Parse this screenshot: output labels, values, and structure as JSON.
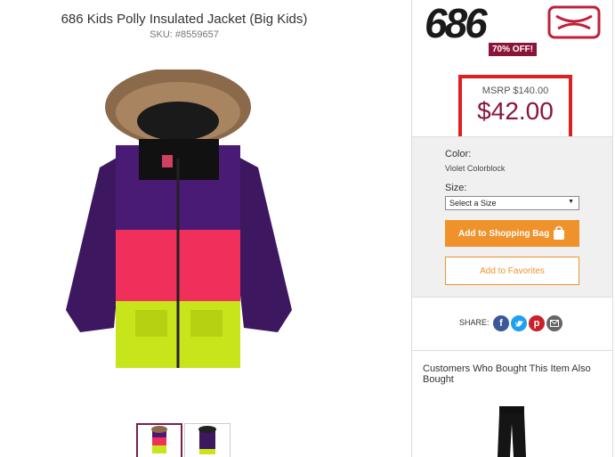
{
  "product": {
    "title": "686 Kids Polly Insulated Jacket (Big Kids)",
    "sku": "SKU: #8559657"
  },
  "brand": {
    "logo_text": "686",
    "discount_badge": "70% OFF!"
  },
  "pricing": {
    "msrp": "MSRP $140.00",
    "price": "$42.00"
  },
  "options": {
    "color_label": "Color:",
    "color_value": "Violet Colorblock",
    "size_label": "Size:",
    "size_placeholder": "Select a Size"
  },
  "actions": {
    "add_to_bag": "Add to Shopping Bag",
    "add_to_favorites": "Add to Favorites"
  },
  "share": {
    "label": "SHARE:",
    "icons": [
      "facebook-icon",
      "twitter-icon",
      "pinterest-icon",
      "email-icon"
    ],
    "colors": {
      "facebook": "#3b5998",
      "twitter": "#1da1f2",
      "pinterest": "#cb2027",
      "email": "#666666"
    }
  },
  "recommendations": {
    "heading": "Customers Who Bought This Item Also Bought"
  },
  "colors": {
    "accent_orange": "#f0922b",
    "price_red": "#8b1538",
    "highlight_box": "#e02020"
  }
}
